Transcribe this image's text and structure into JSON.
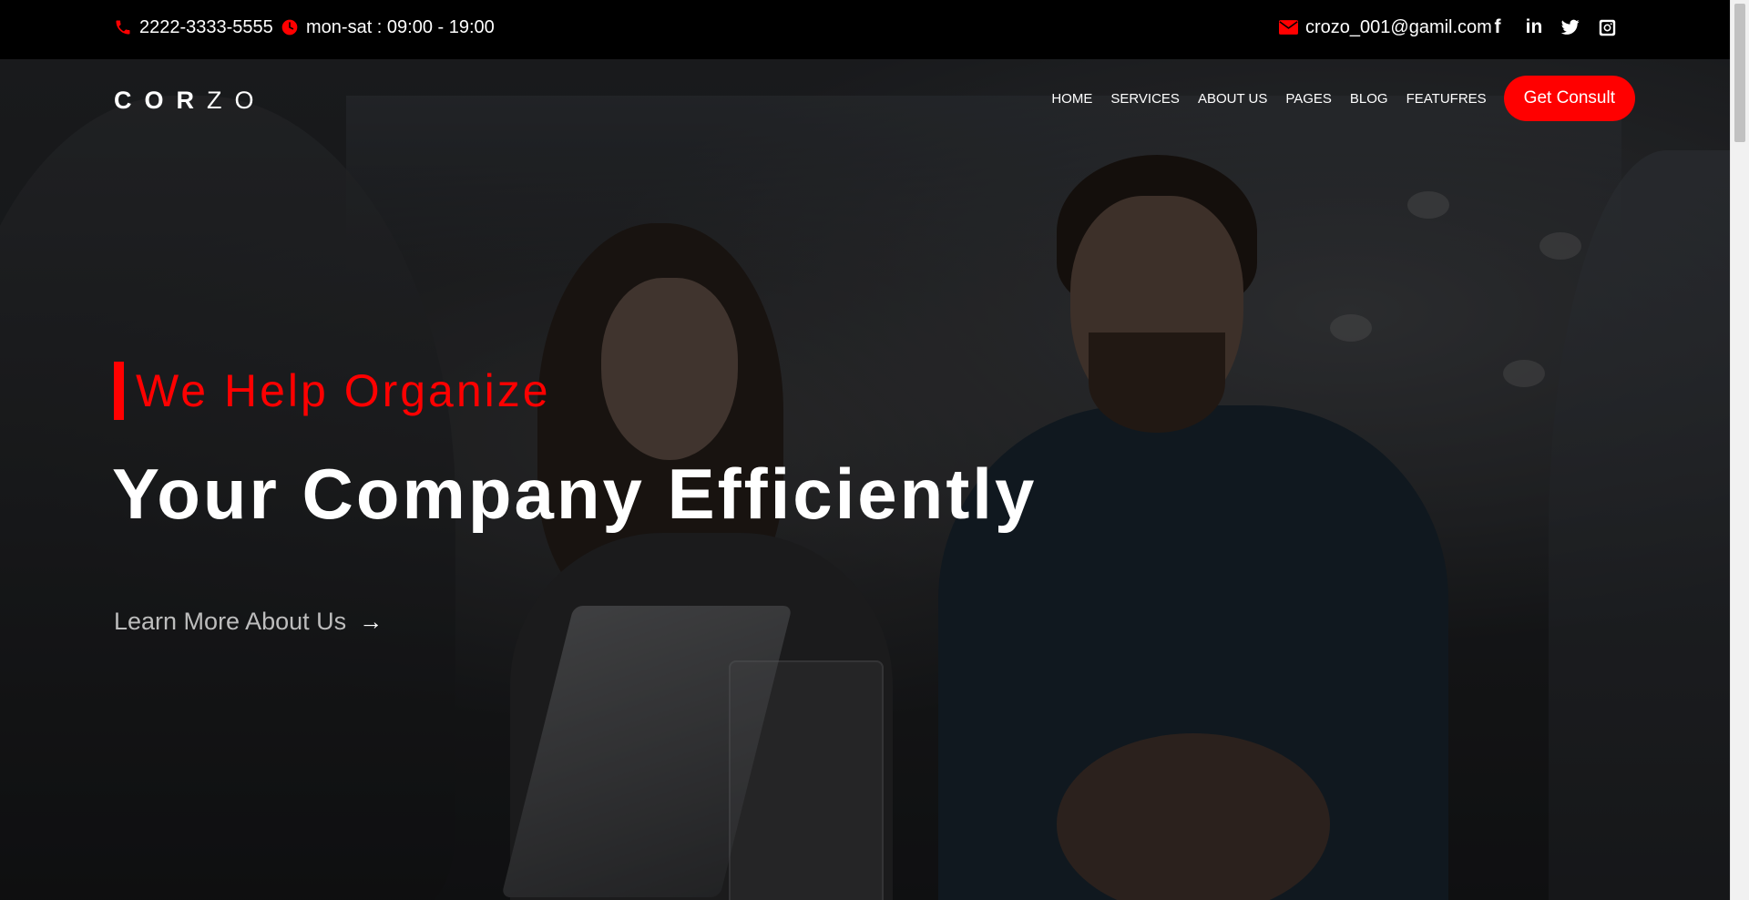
{
  "topbar": {
    "phone": "2222-3333-5555",
    "hours": "mon-sat : 09:00 - 19:00",
    "email": "crozo_001@gamil.com",
    "social": [
      {
        "icon": "facebook-icon",
        "glyph": "f"
      },
      {
        "icon": "linkedin-icon",
        "glyph": "in"
      },
      {
        "icon": "twitter-icon",
        "glyph": ""
      },
      {
        "icon": "instagram-icon",
        "glyph": ""
      }
    ]
  },
  "header": {
    "logo_bold": "COR",
    "logo_light": "ZO",
    "nav": [
      "HOME",
      "SERVICES",
      "ABOUT US",
      "PAGES",
      "BLOG",
      "FEATUFRES"
    ],
    "cta": "Get Consult"
  },
  "hero": {
    "eyebrow": "We Help Organize",
    "headline": "Your Company Efficiently",
    "link": "Learn More About Us",
    "link_arrow": "→"
  },
  "colors": {
    "accent": "#ff0000",
    "topbar_bg": "#000000",
    "text": "#ffffff"
  }
}
